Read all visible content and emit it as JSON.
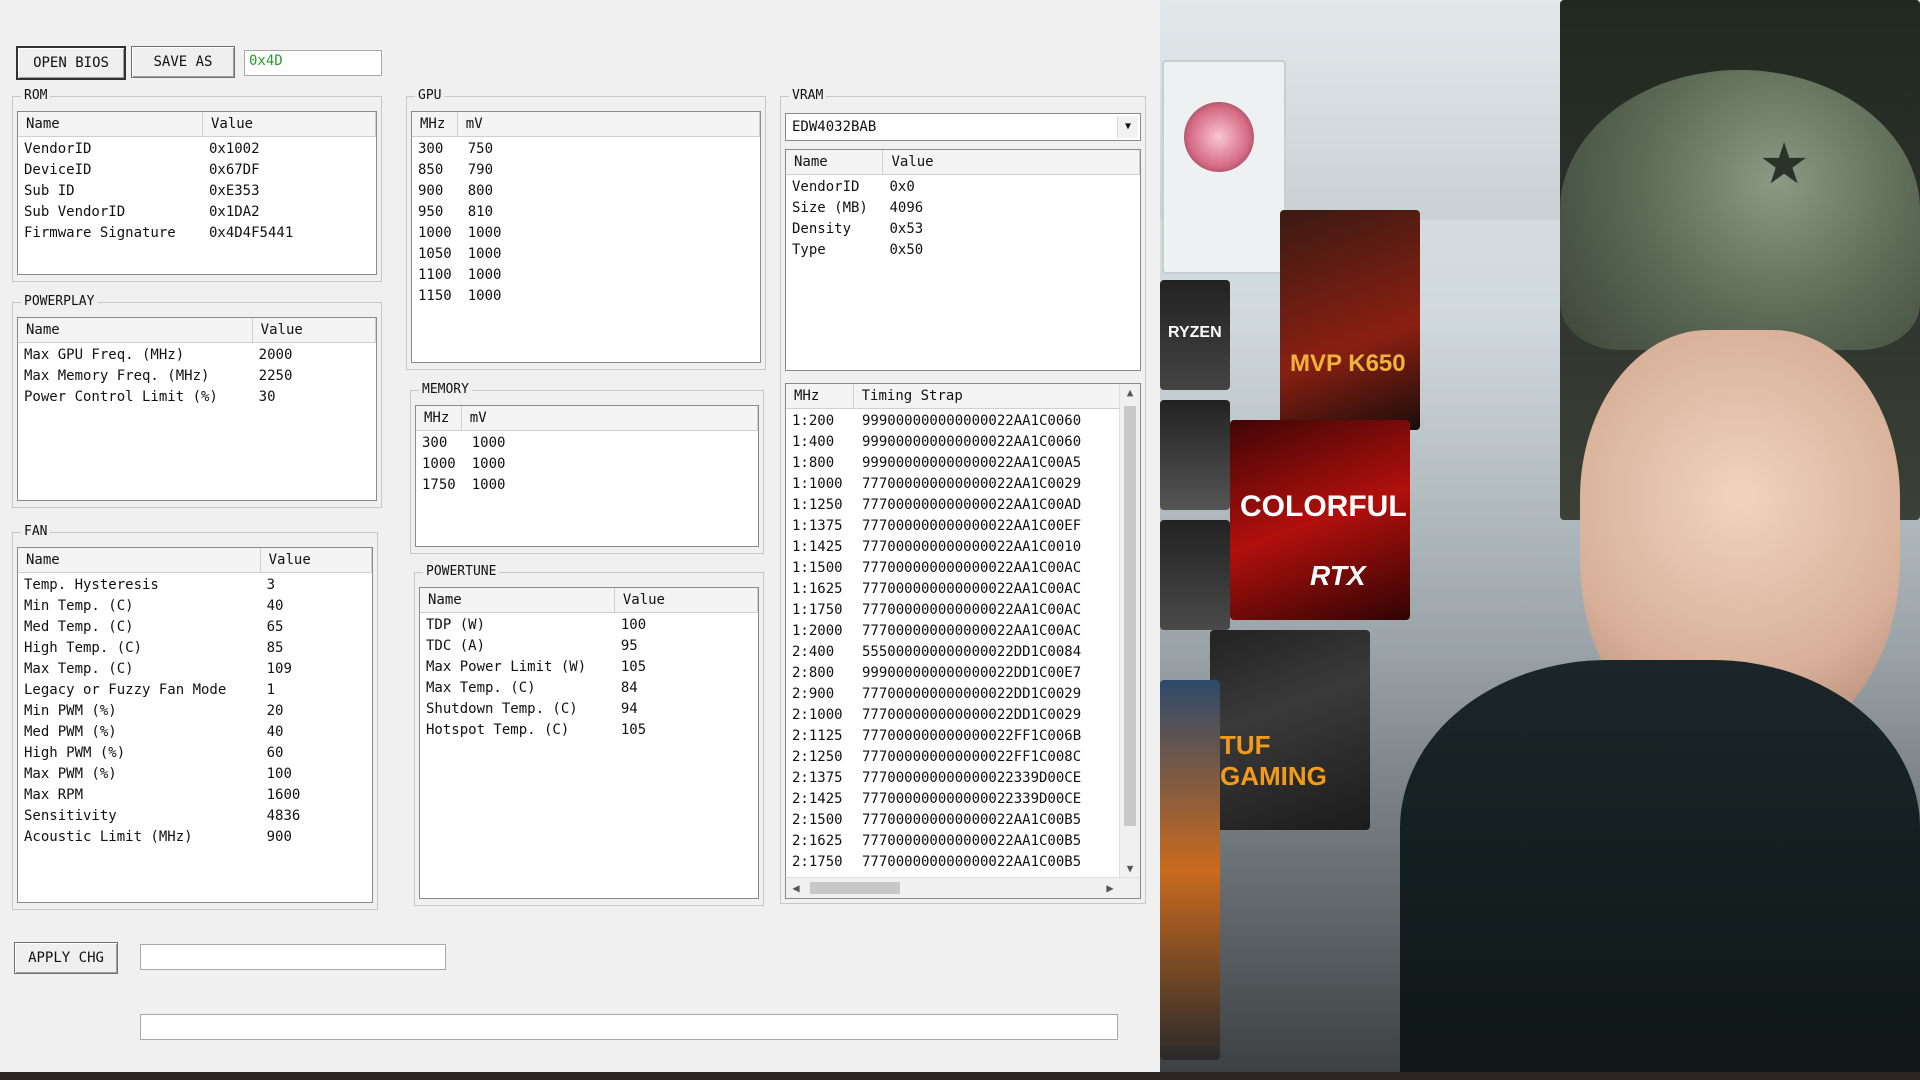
{
  "toolbar": {
    "open_bios_label": "OPEN BIOS",
    "save_as_label": "SAVE AS",
    "checksum_value": "0x4D"
  },
  "rom": {
    "title": "ROM",
    "columns": [
      "Name",
      "Value"
    ],
    "rows": [
      [
        "VendorID",
        "0x1002"
      ],
      [
        "DeviceID",
        "0x67DF"
      ],
      [
        "Sub ID",
        "0xE353"
      ],
      [
        "Sub VendorID",
        "0x1DA2"
      ],
      [
        "Firmware Signature",
        "0x4D4F5441"
      ]
    ]
  },
  "powerplay": {
    "title": "POWERPLAY",
    "columns": [
      "Name",
      "Value"
    ],
    "rows": [
      [
        "Max GPU Freq. (MHz)",
        "2000"
      ],
      [
        "Max Memory Freq. (MHz)",
        "2250"
      ],
      [
        "Power Control Limit (%)",
        "30"
      ]
    ]
  },
  "fan": {
    "title": "FAN",
    "columns": [
      "Name",
      "Value"
    ],
    "rows": [
      [
        "Temp. Hysteresis",
        "3"
      ],
      [
        "Min Temp. (C)",
        "40"
      ],
      [
        "Med Temp. (C)",
        "65"
      ],
      [
        "High Temp. (C)",
        "85"
      ],
      [
        "Max Temp. (C)",
        "109"
      ],
      [
        "Legacy or Fuzzy Fan Mode",
        "1"
      ],
      [
        "Min PWM (%)",
        "20"
      ],
      [
        "Med PWM (%)",
        "40"
      ],
      [
        "High PWM (%)",
        "60"
      ],
      [
        "Max PWM (%)",
        "100"
      ],
      [
        "Max RPM",
        "1600"
      ],
      [
        "Sensitivity",
        "4836"
      ],
      [
        "Acoustic Limit (MHz)",
        "900"
      ]
    ]
  },
  "gpu": {
    "title": "GPU",
    "columns": [
      "MHz",
      "mV"
    ],
    "rows": [
      [
        "300",
        "750"
      ],
      [
        "850",
        "790"
      ],
      [
        "900",
        "800"
      ],
      [
        "950",
        "810"
      ],
      [
        "1000",
        "1000"
      ],
      [
        "1050",
        "1000"
      ],
      [
        "1100",
        "1000"
      ],
      [
        "1150",
        "1000"
      ]
    ]
  },
  "memory": {
    "title": "MEMORY",
    "columns": [
      "MHz",
      "mV"
    ],
    "rows": [
      [
        "300",
        "1000"
      ],
      [
        "1000",
        "1000"
      ],
      [
        "1750",
        "1000"
      ]
    ]
  },
  "powertune": {
    "title": "POWERTUNE",
    "columns": [
      "Name",
      "Value"
    ],
    "rows": [
      [
        "TDP (W)",
        "100"
      ],
      [
        "TDC (A)",
        "95"
      ],
      [
        "Max Power Limit (W)",
        "105"
      ],
      [
        "Max Temp. (C)",
        "84"
      ],
      [
        "Shutdown Temp. (C)",
        "94"
      ],
      [
        "Hotspot Temp. (C)",
        "105"
      ]
    ]
  },
  "vram": {
    "title": "VRAM",
    "selected": "EDW4032BAB",
    "columns": [
      "Name",
      "Value"
    ],
    "rows": [
      [
        "VendorID",
        "0x0"
      ],
      [
        "Size (MB)",
        "4096"
      ],
      [
        "Density",
        "0x53"
      ],
      [
        "Type",
        "0x50"
      ]
    ]
  },
  "timings": {
    "columns": [
      "MHz",
      "Timing Strap"
    ],
    "rows": [
      [
        "1:200",
        "999000000000000022AA1C0060"
      ],
      [
        "1:400",
        "999000000000000022AA1C0060"
      ],
      [
        "1:800",
        "999000000000000022AA1C00A5"
      ],
      [
        "1:1000",
        "777000000000000022AA1C0029"
      ],
      [
        "1:1250",
        "777000000000000022AA1C00AD"
      ],
      [
        "1:1375",
        "777000000000000022AA1C00EF"
      ],
      [
        "1:1425",
        "777000000000000022AA1C0010"
      ],
      [
        "1:1500",
        "777000000000000022AA1C00AC"
      ],
      [
        "1:1625",
        "777000000000000022AA1C00AC"
      ],
      [
        "1:1750",
        "777000000000000022AA1C00AC"
      ],
      [
        "1:2000",
        "777000000000000022AA1C00AC"
      ],
      [
        "2:400",
        "555000000000000022DD1C0084"
      ],
      [
        "2:800",
        "999000000000000022DD1C00E7"
      ],
      [
        "2:900",
        "777000000000000022DD1C0029"
      ],
      [
        "2:1000",
        "777000000000000022DD1C0029"
      ],
      [
        "2:1125",
        "777000000000000022FF1C006B"
      ],
      [
        "2:1250",
        "777000000000000022FF1C008C"
      ],
      [
        "2:1375",
        "777000000000000022339D00CE"
      ],
      [
        "2:1425",
        "777000000000000022339D00CE"
      ],
      [
        "2:1500",
        "777000000000000022AA1C00B5"
      ],
      [
        "2:1625",
        "777000000000000022AA1C00B5"
      ],
      [
        "2:1750",
        "777000000000000022AA1C00B5"
      ]
    ]
  },
  "footer": {
    "apply_label": "APPLY CHG",
    "input1_value": "",
    "input2_value": ""
  },
  "webcam": {
    "labels": [
      "RYZEN",
      "MVP K650",
      "COLORFUL",
      "RTX",
      "TUF GAMING"
    ]
  }
}
